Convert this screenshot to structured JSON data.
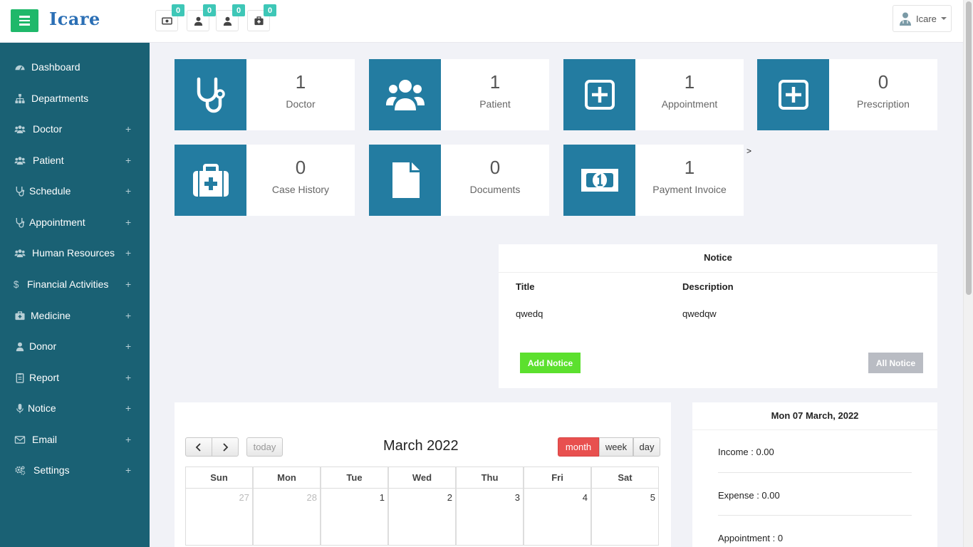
{
  "brand": "Icare",
  "header": {
    "notifications": [
      {
        "icon": "money-icon",
        "count": "0"
      },
      {
        "icon": "user-icon",
        "count": "0"
      },
      {
        "icon": "user-icon",
        "count": "0"
      },
      {
        "icon": "medkit-icon",
        "count": "0"
      }
    ],
    "user_name": "Icare"
  },
  "sidebar": {
    "items": [
      {
        "label": "Dashboard",
        "icon": "dashboard-icon",
        "plus": ""
      },
      {
        "label": "Departments",
        "icon": "sitemap-icon",
        "plus": ""
      },
      {
        "label": "Doctor",
        "icon": "users-icon",
        "plus": "+"
      },
      {
        "label": "Patient",
        "icon": "users-icon",
        "plus": "+"
      },
      {
        "label": "Schedule",
        "icon": "stethoscope-icon",
        "plus": "+"
      },
      {
        "label": "Appointment",
        "icon": "stethoscope-icon",
        "plus": "+"
      },
      {
        "label": "Human Resources",
        "icon": "users-icon",
        "plus": "+"
      },
      {
        "label": "Financial Activities",
        "icon": "dollar-icon",
        "plus": "+"
      },
      {
        "label": "Medicine",
        "icon": "medkit-icon",
        "plus": "+"
      },
      {
        "label": "Donor",
        "icon": "user-icon",
        "plus": "+"
      },
      {
        "label": "Report",
        "icon": "clipboard-icon",
        "plus": "+"
      },
      {
        "label": "Notice",
        "icon": "microphone-icon",
        "plus": "+"
      },
      {
        "label": "Email",
        "icon": "envelope-icon",
        "plus": "+"
      },
      {
        "label": "Settings",
        "icon": "gears-icon",
        "plus": "+"
      }
    ]
  },
  "stats": [
    {
      "value": "1",
      "label": "Doctor",
      "icon": "stethoscope-icon"
    },
    {
      "value": "1",
      "label": "Patient",
      "icon": "users-icon"
    },
    {
      "value": "1",
      "label": "Appointment",
      "icon": "plus-square-icon"
    },
    {
      "value": "0",
      "label": "Prescription",
      "icon": "plus-square-icon"
    },
    {
      "value": "0",
      "label": "Case History",
      "icon": "medkit-icon"
    },
    {
      "value": "0",
      "label": "Documents",
      "icon": "file-icon"
    },
    {
      "value": "1",
      "label": "Payment Invoice",
      "icon": "money-icon"
    }
  ],
  "stray_char": ">",
  "notice": {
    "heading": "Notice",
    "col_title": "Title",
    "col_description": "Description",
    "rows": [
      {
        "title": "qwedq",
        "description": "qwedqw"
      }
    ],
    "add_button": "Add Notice",
    "all_button": "All Notice"
  },
  "calendar": {
    "title": "March 2022",
    "prev": "‹",
    "next": "›",
    "today": "today",
    "views": [
      "month",
      "week",
      "day"
    ],
    "active_view": "month",
    "weekdays": [
      "Sun",
      "Mon",
      "Tue",
      "Wed",
      "Thu",
      "Fri",
      "Sat"
    ],
    "first_week": [
      {
        "day": "27",
        "other": true
      },
      {
        "day": "28",
        "other": true
      },
      {
        "day": "1",
        "other": false
      },
      {
        "day": "2",
        "other": false
      },
      {
        "day": "3",
        "other": false
      },
      {
        "day": "4",
        "other": false
      },
      {
        "day": "5",
        "other": false
      }
    ]
  },
  "summary": {
    "date": "Mon 07 March, 2022",
    "income": "Income : 0.00",
    "expense": "Expense : 0.00",
    "appointment": "Appointment : 0"
  },
  "colors": {
    "sidebar": "#1a6174",
    "card_icon": "#237ca1",
    "menu_button": "#1fb86a",
    "badge": "#3ec7b7",
    "add_notice": "#5ce02e",
    "active_view": "#e8504f"
  }
}
